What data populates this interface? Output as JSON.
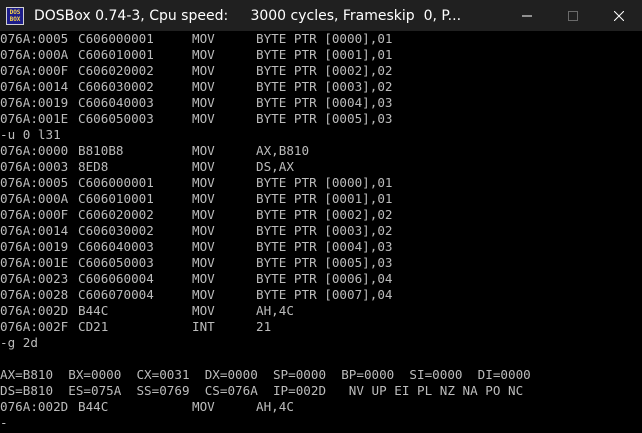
{
  "window": {
    "title": "DOSBox 0.74-3, Cpu speed:     3000 cycles, Frameskip  0, P...",
    "icon_top": "DOS",
    "icon_bottom": "BOX",
    "minimize_icon": "minimize-icon",
    "maximize_icon": "maximize-icon",
    "close_icon": "close-icon"
  },
  "console": {
    "block1": [
      {
        "addr": "076A:0005",
        "code": "C606000001",
        "op": "MOV",
        "arg": "BYTE PTR [0000],01"
      },
      {
        "addr": "076A:000A",
        "code": "C606010001",
        "op": "MOV",
        "arg": "BYTE PTR [0001],01"
      },
      {
        "addr": "076A:000F",
        "code": "C606020002",
        "op": "MOV",
        "arg": "BYTE PTR [0002],02"
      },
      {
        "addr": "076A:0014",
        "code": "C606030002",
        "op": "MOV",
        "arg": "BYTE PTR [0003],02"
      },
      {
        "addr": "076A:0019",
        "code": "C606040003",
        "op": "MOV",
        "arg": "BYTE PTR [0004],03"
      },
      {
        "addr": "076A:001E",
        "code": "C606050003",
        "op": "MOV",
        "arg": "BYTE PTR [0005],03"
      }
    ],
    "cmd1": "-u 0 l31",
    "block2": [
      {
        "addr": "076A:0000",
        "code": "B810B8",
        "op": "MOV",
        "arg": "AX,B810"
      },
      {
        "addr": "076A:0003",
        "code": "8ED8",
        "op": "MOV",
        "arg": "DS,AX"
      },
      {
        "addr": "076A:0005",
        "code": "C606000001",
        "op": "MOV",
        "arg": "BYTE PTR [0000],01"
      },
      {
        "addr": "076A:000A",
        "code": "C606010001",
        "op": "MOV",
        "arg": "BYTE PTR [0001],01"
      },
      {
        "addr": "076A:000F",
        "code": "C606020002",
        "op": "MOV",
        "arg": "BYTE PTR [0002],02"
      },
      {
        "addr": "076A:0014",
        "code": "C606030002",
        "op": "MOV",
        "arg": "BYTE PTR [0003],02"
      },
      {
        "addr": "076A:0019",
        "code": "C606040003",
        "op": "MOV",
        "arg": "BYTE PTR [0004],03"
      },
      {
        "addr": "076A:001E",
        "code": "C606050003",
        "op": "MOV",
        "arg": "BYTE PTR [0005],03"
      },
      {
        "addr": "076A:0023",
        "code": "C606060004",
        "op": "MOV",
        "arg": "BYTE PTR [0006],04"
      },
      {
        "addr": "076A:0028",
        "code": "C606070004",
        "op": "MOV",
        "arg": "BYTE PTR [0007],04"
      },
      {
        "addr": "076A:002D",
        "code": "B44C",
        "op": "MOV",
        "arg": "AH,4C"
      },
      {
        "addr": "076A:002F",
        "code": "CD21",
        "op": "INT",
        "arg": "21"
      }
    ],
    "cmd2": "-g 2d",
    "regs1": "AX=B810  BX=0000  CX=0031  DX=0000  SP=0000  BP=0000  SI=0000  DI=0000",
    "regs2": "DS=B810  ES=075A  SS=0769  CS=076A  IP=002D   NV UP EI PL NZ NA PO NC",
    "current": {
      "addr": "076A:002D",
      "code": "B44C",
      "op": "MOV",
      "arg": "AH,4C"
    },
    "prompt": "-",
    "cursor_icon": "mouse-cursor-icon"
  }
}
